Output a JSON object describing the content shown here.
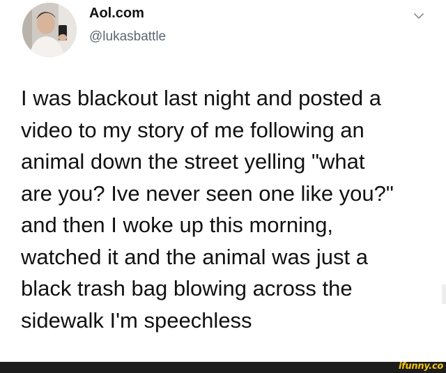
{
  "tweet": {
    "display_name": "Aol.com",
    "handle": "@lukasbattle",
    "menu_icon": "chevron-down-icon",
    "text_lines": [
      "I was blackout last night and posted a",
      "video to my story of me following an",
      "animal down the street yelling \"what",
      "are you? Ive never seen one like you?\"",
      "and then I woke up this morning,",
      "watched it and the animal was just a",
      "black trash bag blowing across the",
      "sidewalk I'm speechless"
    ]
  },
  "footer": {
    "watermark": "ifunny.co"
  },
  "colors": {
    "text": "#111111",
    "handle": "#5b6670",
    "footer_bar": "#1c1c1c",
    "watermark": "#f2c40f"
  }
}
